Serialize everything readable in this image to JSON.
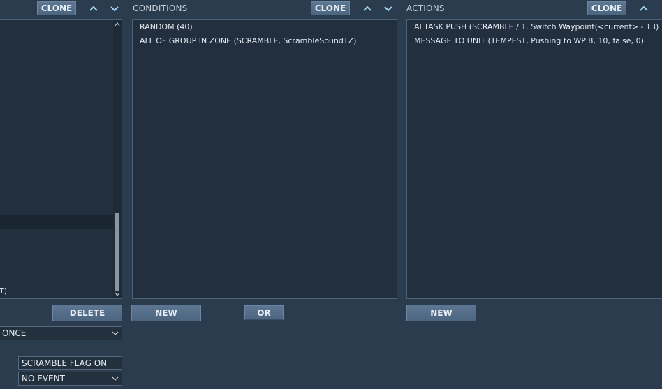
{
  "left_column": {
    "clone_label": "CLONE",
    "list_fragment_text": "T)",
    "delete_label": "DELETE",
    "frequency_select_value": "ONCE",
    "trigger_name_value": "SCRAMBLE FLAG ON",
    "event_select_value": "NO EVENT"
  },
  "conditions": {
    "title": "CONDITIONS",
    "clone_label": "CLONE",
    "items": [
      "RANDOM (40)",
      "ALL OF GROUP IN ZONE (SCRAMBLE, ScrambleSoundTZ)"
    ],
    "new_label": "NEW",
    "or_label": "OR"
  },
  "actions": {
    "title": "ACTIONS",
    "clone_label": "CLONE",
    "items": [
      "AI TASK PUSH (SCRAMBLE / 1. Switch Waypoint(<current> - 13) )",
      "MESSAGE TO UNIT (TEMPEST, Pushing to WP 8, 10, false, 0)"
    ],
    "new_label": "NEW"
  },
  "colors": {
    "background": "#2c3c4f",
    "panel": "#212f3e",
    "button": "#53708c",
    "arrow": "#9fd4f2",
    "selected_row": "#1a2532"
  },
  "icons": [
    "chevron-up-icon",
    "chevron-down-icon",
    "scroll-up-icon",
    "scroll-down-icon",
    "dropdown-chevron-icon"
  ]
}
